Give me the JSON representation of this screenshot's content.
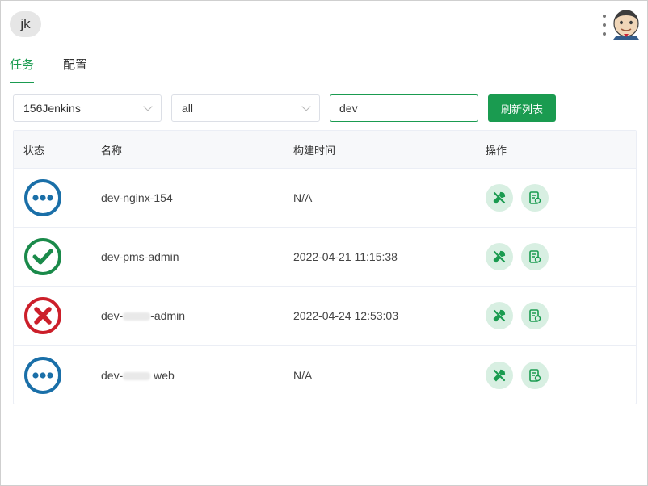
{
  "header": {
    "user_initials": "jk"
  },
  "tabs": [
    {
      "label": "任务",
      "active": true
    },
    {
      "label": "配置",
      "active": false
    }
  ],
  "filters": {
    "server_select": "156Jenkins",
    "view_select": "all",
    "search_value": "dev",
    "refresh_label": "刷新列表"
  },
  "table": {
    "columns": {
      "status": "状态",
      "name": "名称",
      "build_time": "构建时间",
      "ops": "操作"
    },
    "rows": [
      {
        "status": "running",
        "name_prefix": "dev-nginx-154",
        "name_suffix": "",
        "name_redacted": false,
        "build_time": "N/A"
      },
      {
        "status": "success",
        "name_prefix": "dev-pms-admin",
        "name_suffix": "",
        "name_redacted": false,
        "build_time": "2022-04-21 11:15:38"
      },
      {
        "status": "failed",
        "name_prefix": "dev-",
        "name_suffix": "-admin",
        "name_redacted": true,
        "build_time": "2022-04-24 12:53:03"
      },
      {
        "status": "running",
        "name_prefix": "dev-",
        "name_suffix": "web",
        "name_redacted": true,
        "build_time": "N/A"
      }
    ]
  },
  "icons": {
    "build": "build-wrench-icon",
    "log": "console-log-icon",
    "running": "ellipsis-status-icon",
    "success": "check-status-icon",
    "failed": "cross-status-icon"
  },
  "colors": {
    "accent": "#1a9b50",
    "running": "#1a6fa8",
    "success": "#1a8a4a",
    "failed": "#cc1f2a"
  }
}
